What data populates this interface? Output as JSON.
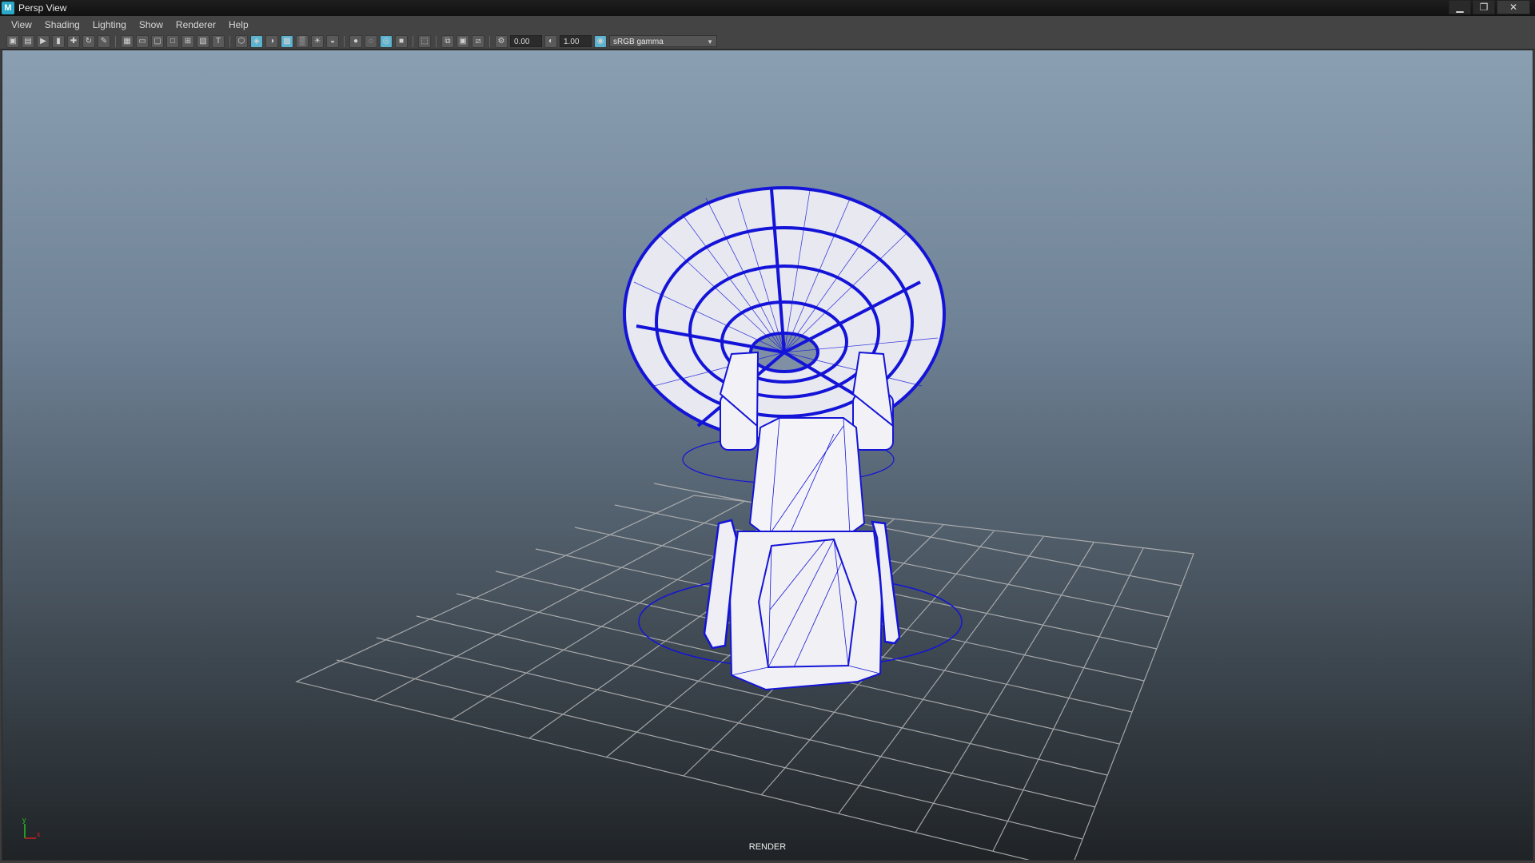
{
  "window": {
    "app_icon_letter": "M",
    "title": "Persp View",
    "controls": [
      "minimize-icon",
      "restore-icon",
      "close-icon"
    ]
  },
  "menu": {
    "items": [
      "View",
      "Shading",
      "Lighting",
      "Show",
      "Renderer",
      "Help"
    ]
  },
  "toolbar": {
    "near_clip_value": "0.00",
    "far_clip_value": "1.00",
    "color_space": "sRGB gamma",
    "icons": [
      "camera-icon",
      "camera-select-icon",
      "camera-next-icon",
      "bookmark-icon",
      "pan-icon",
      "tumble-icon",
      "pencil-icon",
      "grid-icon",
      "film-gate-icon",
      "resolution-gate-icon",
      "gate-mask-icon",
      "field-chart-icon",
      "safe-action-icon",
      "safe-title-icon",
      "wireframe-icon",
      "smooth-shade-icon",
      "wireframe-on-shaded-icon",
      "textured-icon",
      "checker-icon",
      "light-icon",
      "shadow-icon",
      "ambient-occlusion-icon",
      "motion-blur-icon",
      "antialias-icon",
      "xray-icon",
      "isolate-icon",
      "component-icon",
      "backface-icon",
      "joints-icon",
      "exposure-icon",
      "gamma-icon",
      "color-mgmt-icon"
    ],
    "active_icons": [
      "smooth-shade-icon",
      "wireframe-on-shaded-icon",
      "antialias-icon",
      "color-mgmt-icon"
    ]
  },
  "viewport": {
    "hud_label": "RENDER",
    "axis_labels": {
      "y": "y",
      "x": "x"
    },
    "colors": {
      "wireframe": "#1414d8",
      "grid": "#b8b8b8",
      "mesh_fill": "#f2f2f6",
      "axis_y": "#22c322",
      "axis_x": "#d02020"
    }
  }
}
